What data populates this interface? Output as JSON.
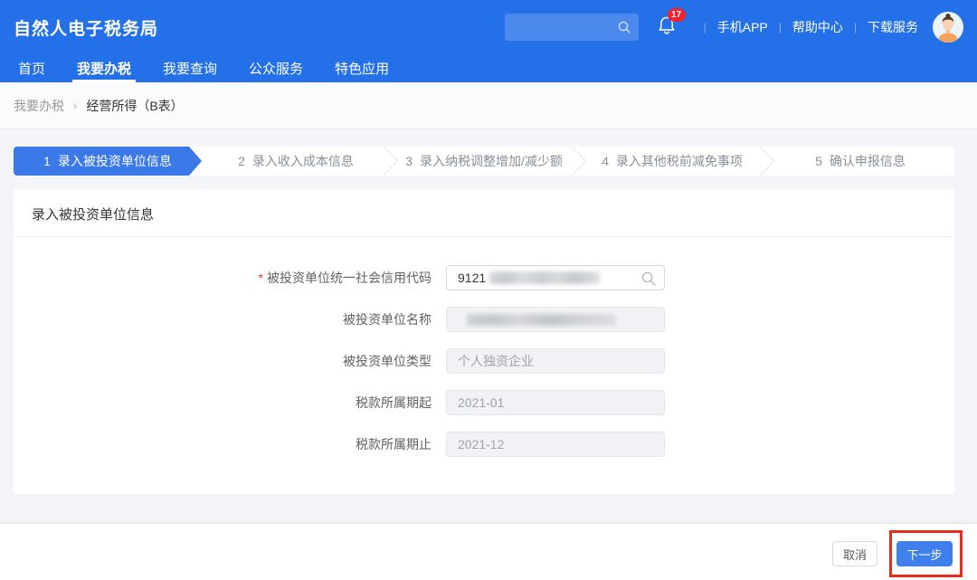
{
  "header": {
    "title": "自然人电子税务局",
    "search_placeholder": "",
    "badge_count": "17",
    "links": [
      "手机APP",
      "帮助中心",
      "下载服务"
    ],
    "divider": "|"
  },
  "nav": {
    "items": [
      {
        "label": "首页",
        "active": false
      },
      {
        "label": "我要办税",
        "active": true
      },
      {
        "label": "我要查询",
        "active": false
      },
      {
        "label": "公众服务",
        "active": false
      },
      {
        "label": "特色应用",
        "active": false
      }
    ]
  },
  "breadcrumb": {
    "parent": "我要办税",
    "separator": "›",
    "current": "经营所得（B表）"
  },
  "steps": [
    {
      "number": "1",
      "label": "录入被投资单位信息",
      "active": true
    },
    {
      "number": "2",
      "label": "录入收入成本信息",
      "active": false
    },
    {
      "number": "3",
      "label": "录入纳税调整增加/减少额",
      "active": false
    },
    {
      "number": "4",
      "label": "录入其他税前减免事项",
      "active": false
    },
    {
      "number": "5",
      "label": "确认申报信息",
      "active": false
    }
  ],
  "form": {
    "section_title": "录入被投资单位信息",
    "required_marker": "*",
    "fields": [
      {
        "label": "被投资单位统一社会信用代码",
        "value": "9121",
        "required": true,
        "redacted": true,
        "disabled": false
      },
      {
        "label": "被投资单位名称",
        "value": "",
        "required": false,
        "redacted": true,
        "disabled": true
      },
      {
        "label": "被投资单位类型",
        "value": "个人独资企业",
        "required": false,
        "redacted": false,
        "disabled": true
      },
      {
        "label": "税款所属期起",
        "value": "2021-01",
        "required": false,
        "redacted": false,
        "disabled": true
      },
      {
        "label": "税款所属期止",
        "value": "2021-12",
        "required": false,
        "redacted": false,
        "disabled": true
      }
    ]
  },
  "footer": {
    "cancel_label": "取消",
    "next_label": "下一步"
  },
  "colors": {
    "primary_blue": "#2470e8",
    "step_active_blue": "#3b78e8",
    "button_blue": "#4080ed",
    "badge_red": "#f5222d",
    "annotation_red": "#e82b1e"
  }
}
